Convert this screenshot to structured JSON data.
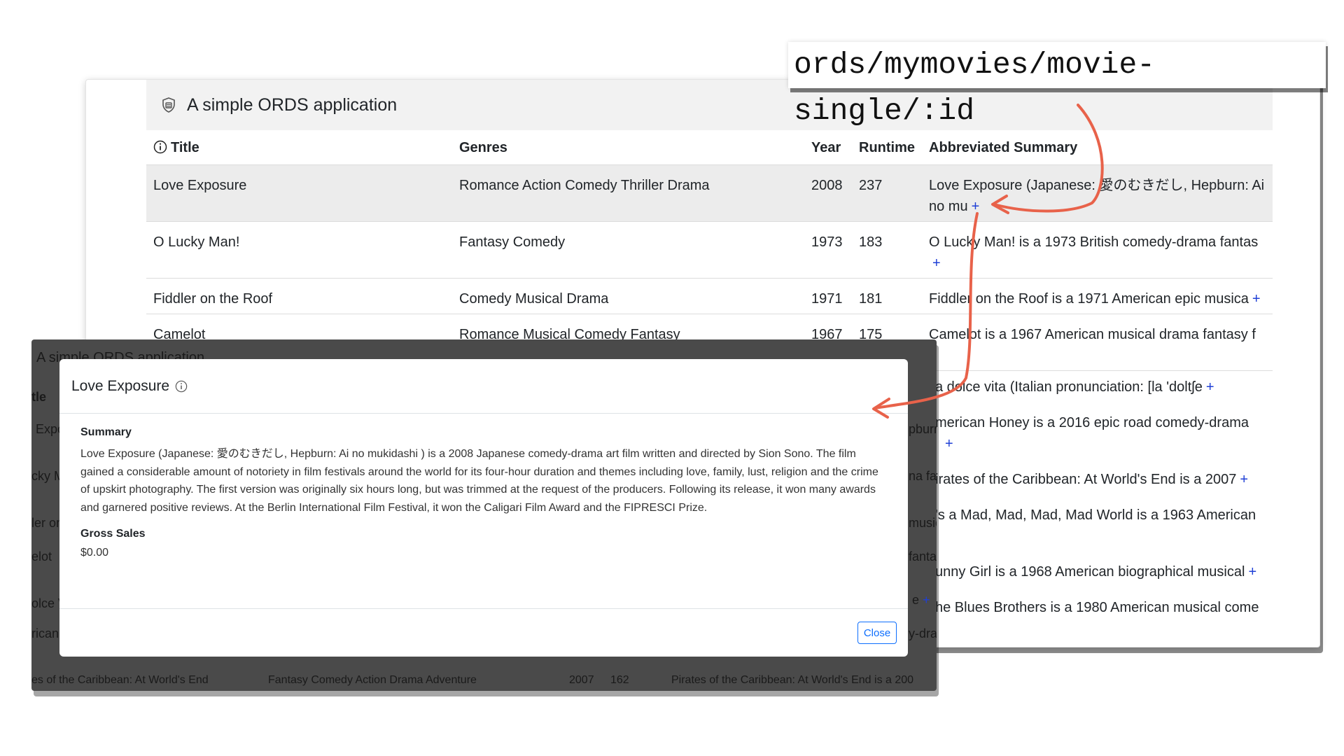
{
  "route": "ords/mymovies/movie-single/:id",
  "accent_color": "#e8624a",
  "app": {
    "title": "A simple ORDS application",
    "logo_icon": "app-logo-icon"
  },
  "table": {
    "headers": {
      "title": "Title",
      "genres": "Genres",
      "year": "Year",
      "runtime": "Runtime",
      "summary": "Abbreviated Summary"
    },
    "rows": [
      {
        "title": "Love Exposure",
        "genres": "Romance Action Comedy Thriller Drama",
        "year": "2008",
        "runtime": "237",
        "summary": "Love Exposure (Japanese: 愛のむきだし, Hepburn: Ai no mu"
      },
      {
        "title": "O Lucky Man!",
        "genres": "Fantasy Comedy",
        "year": "1973",
        "runtime": "183",
        "summary": "O Lucky Man! is a 1973 British comedy-drama fantas"
      },
      {
        "title": "Fiddler on the Roof",
        "genres": "Comedy Musical Drama",
        "year": "1971",
        "runtime": "181",
        "summary": "Fiddler on the Roof is a 1971 American epic musica"
      },
      {
        "title": "Camelot",
        "genres": "Romance Musical Comedy Fantasy",
        "year": "1967",
        "runtime": "175",
        "summary": "Camelot is a 1967 American musical drama fantasy f"
      }
    ],
    "visible_summaries": [
      "a dolce vita (Italian pronunciation: [la 'doltʃe",
      "merican Honey is a 2016 epic road comedy-drama",
      "irates of the Caribbean: At World's End is a 2007",
      "'s a Mad, Mad, Mad, Mad World is a 1963 American",
      "unny Girl is a 1968 American biographical musical",
      "he Blues Brothers is a 1980 American musical come"
    ],
    "expand_symbol": "+"
  },
  "overlay": {
    "app_title": "A simple ORDS application",
    "left_fragments": [
      "tle",
      "Expo",
      "cky M",
      "ler on",
      "elot",
      "olce V",
      "rican"
    ],
    "right_fragments": [
      "pburn",
      "na fa",
      "music",
      "fanta",
      "e",
      "y-dra"
    ],
    "bottom_row": {
      "title": "es of the Caribbean: At World's End",
      "genres": "Fantasy Comedy Action Drama Adventure",
      "year": "2007",
      "runtime": "162",
      "summary": "Pirates of the Caribbean: At World's End is a 200"
    }
  },
  "modal": {
    "title": "Love Exposure",
    "summary_label": "Summary",
    "summary": "Love Exposure (Japanese: 愛のむきだし, Hepburn: Ai no mukidashi ) is a 2008 Japanese comedy-drama art film written and directed by Sion Sono. The film gained a considerable amount of notoriety in film festivals around the world for its four-hour duration and themes including love, family, lust, religion and the crime of upskirt photography. The first version was originally six hours long, but was trimmed at the request of the producers. Following its release, it won many awards and garnered positive reviews. At the Berlin International Film Festival, it won the Caligari Film Award and the FIPRESCI Prize.",
    "gross_label": "Gross Sales",
    "gross_value": "$0.00",
    "close_label": "Close"
  }
}
